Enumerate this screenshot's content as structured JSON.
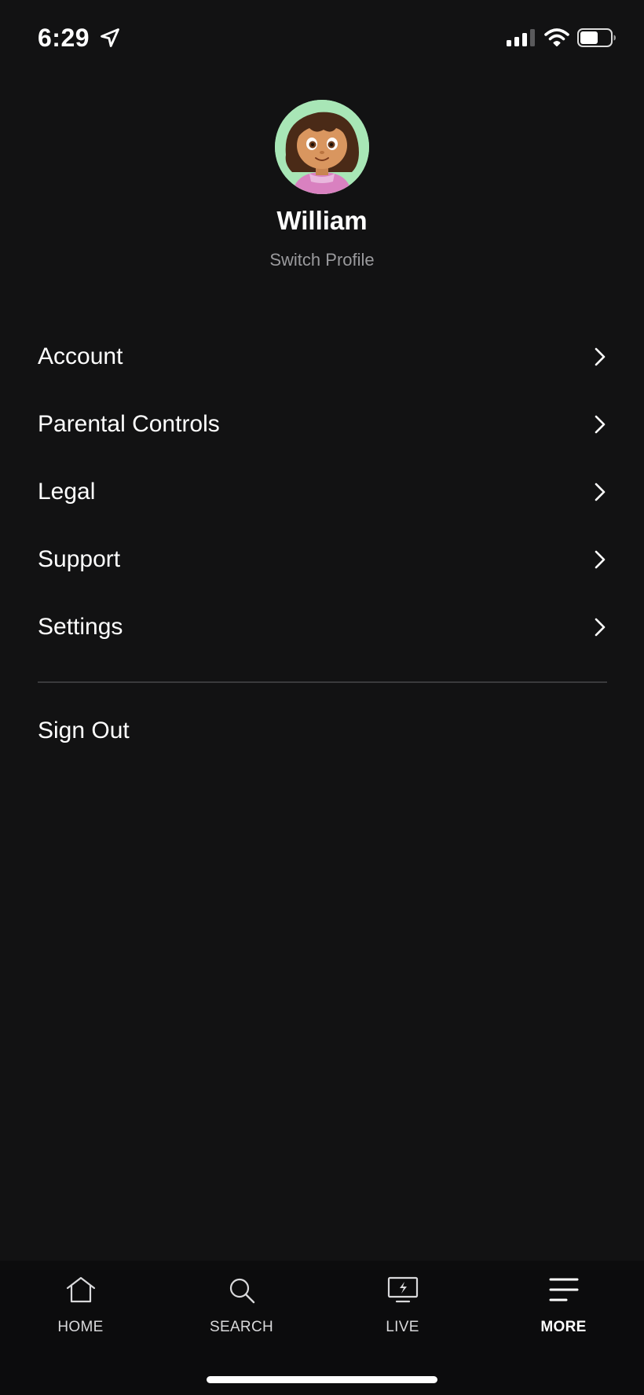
{
  "status_bar": {
    "time": "6:29",
    "location_icon": "location-arrow-icon",
    "signal_icon": "cellular-signal-icon",
    "wifi_icon": "wifi-icon",
    "battery_icon": "battery-icon"
  },
  "profile": {
    "name": "William",
    "switch_label": "Switch Profile",
    "avatar_icon": "profile-avatar"
  },
  "menu": {
    "items": [
      {
        "label": "Account"
      },
      {
        "label": "Parental Controls"
      },
      {
        "label": "Legal"
      },
      {
        "label": "Support"
      },
      {
        "label": "Settings"
      }
    ],
    "sign_out_label": "Sign Out"
  },
  "tab_bar": {
    "tabs": [
      {
        "label": "HOME",
        "icon": "home-icon"
      },
      {
        "label": "SEARCH",
        "icon": "search-icon"
      },
      {
        "label": "LIVE",
        "icon": "live-tv-icon"
      },
      {
        "label": "MORE",
        "icon": "menu-icon",
        "active": true
      }
    ]
  },
  "colors": {
    "background": "#121213",
    "tab_bar_background": "#0c0c0d",
    "text_primary": "#ffffff",
    "text_secondary": "#9a9a9d",
    "divider": "#3a3a3c"
  }
}
